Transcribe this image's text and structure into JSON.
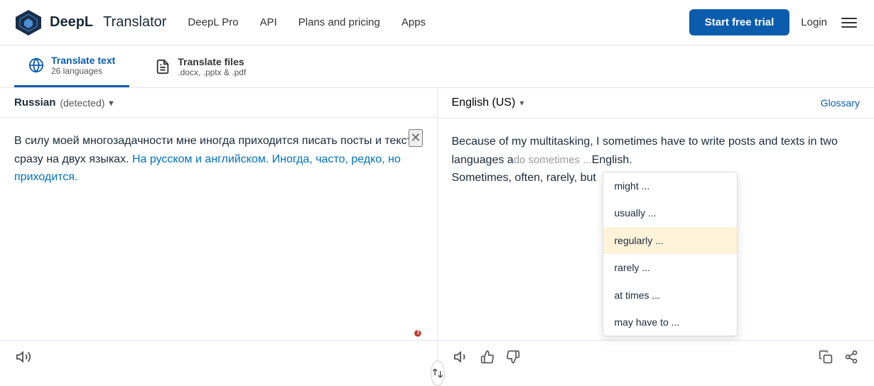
{
  "header": {
    "logo_brand": "DeepL",
    "logo_type": "Translator",
    "nav_items": [
      {
        "label": "DeepL Pro"
      },
      {
        "label": "API"
      },
      {
        "label": "Plans and pricing"
      },
      {
        "label": "Apps"
      }
    ],
    "btn_trial": "Start free trial",
    "btn_login": "Login"
  },
  "tabs": [
    {
      "id": "translate-text",
      "label": "Translate text",
      "sub": "26 languages",
      "active": true
    },
    {
      "id": "translate-files",
      "label": "Translate files",
      "sub": ".docx, .pptx & .pdf",
      "active": false
    }
  ],
  "left_panel": {
    "lang_label": "Russian",
    "lang_detected": "(detected)",
    "text_normal": "В силу моей многозадачности мне иногда приходится писать посты и тексты сразу на двух языках.",
    "text_highlight": "На русском и английском.",
    "text_end": "Иногда, часто, редко, но приходится."
  },
  "right_panel": {
    "lang_label": "English (US)",
    "glossary_label": "Glossary",
    "text_before": "Because of my multitasking, I sometimes have to write posts and texts in two languages a",
    "text_ghost": "do sometimes ...",
    "text_after": "English.",
    "text_line2": "Sometimes, often, rarely, but",
    "suggestions": [
      {
        "label": "might ...",
        "highlighted": false
      },
      {
        "label": "usually ...",
        "highlighted": false
      },
      {
        "label": "regularly ...",
        "highlighted": true
      },
      {
        "label": "rarely ...",
        "highlighted": false
      },
      {
        "label": "at times ...",
        "highlighted": false
      },
      {
        "label": "may have to ...",
        "highlighted": false
      }
    ]
  },
  "icons": {
    "speaker": "🔊",
    "thumbs_up": "👍",
    "thumbs_down": "👎",
    "copy": "⧉",
    "share": "⎘",
    "swap": "⇄",
    "globe": "🌐",
    "file": "📄",
    "error": "❗",
    "close": "✕"
  }
}
